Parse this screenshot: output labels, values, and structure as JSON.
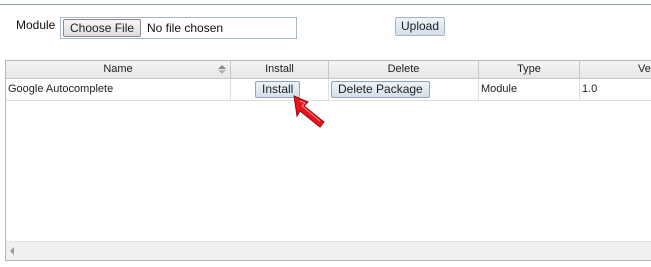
{
  "upload_form": {
    "module_label": "Module",
    "choose_file_label": "Choose File",
    "file_status": "No file chosen",
    "upload_label": "Upload"
  },
  "grid": {
    "columns": [
      "Name",
      "Install",
      "Delete",
      "Type",
      "Ver"
    ],
    "rows": [
      {
        "name": "Google Autocomplete",
        "install_label": "Install",
        "delete_label": "Delete Package",
        "type": "Module",
        "version": "1.0"
      }
    ]
  },
  "icons": {
    "sort": "sort-up-down-icon",
    "scroll_left": "scroll-left-arrow-icon",
    "pointer": "red-pointer-arrow-icon"
  },
  "colors": {
    "accent_line": "#7aa6c9",
    "pointer_red": "#e8141b"
  }
}
